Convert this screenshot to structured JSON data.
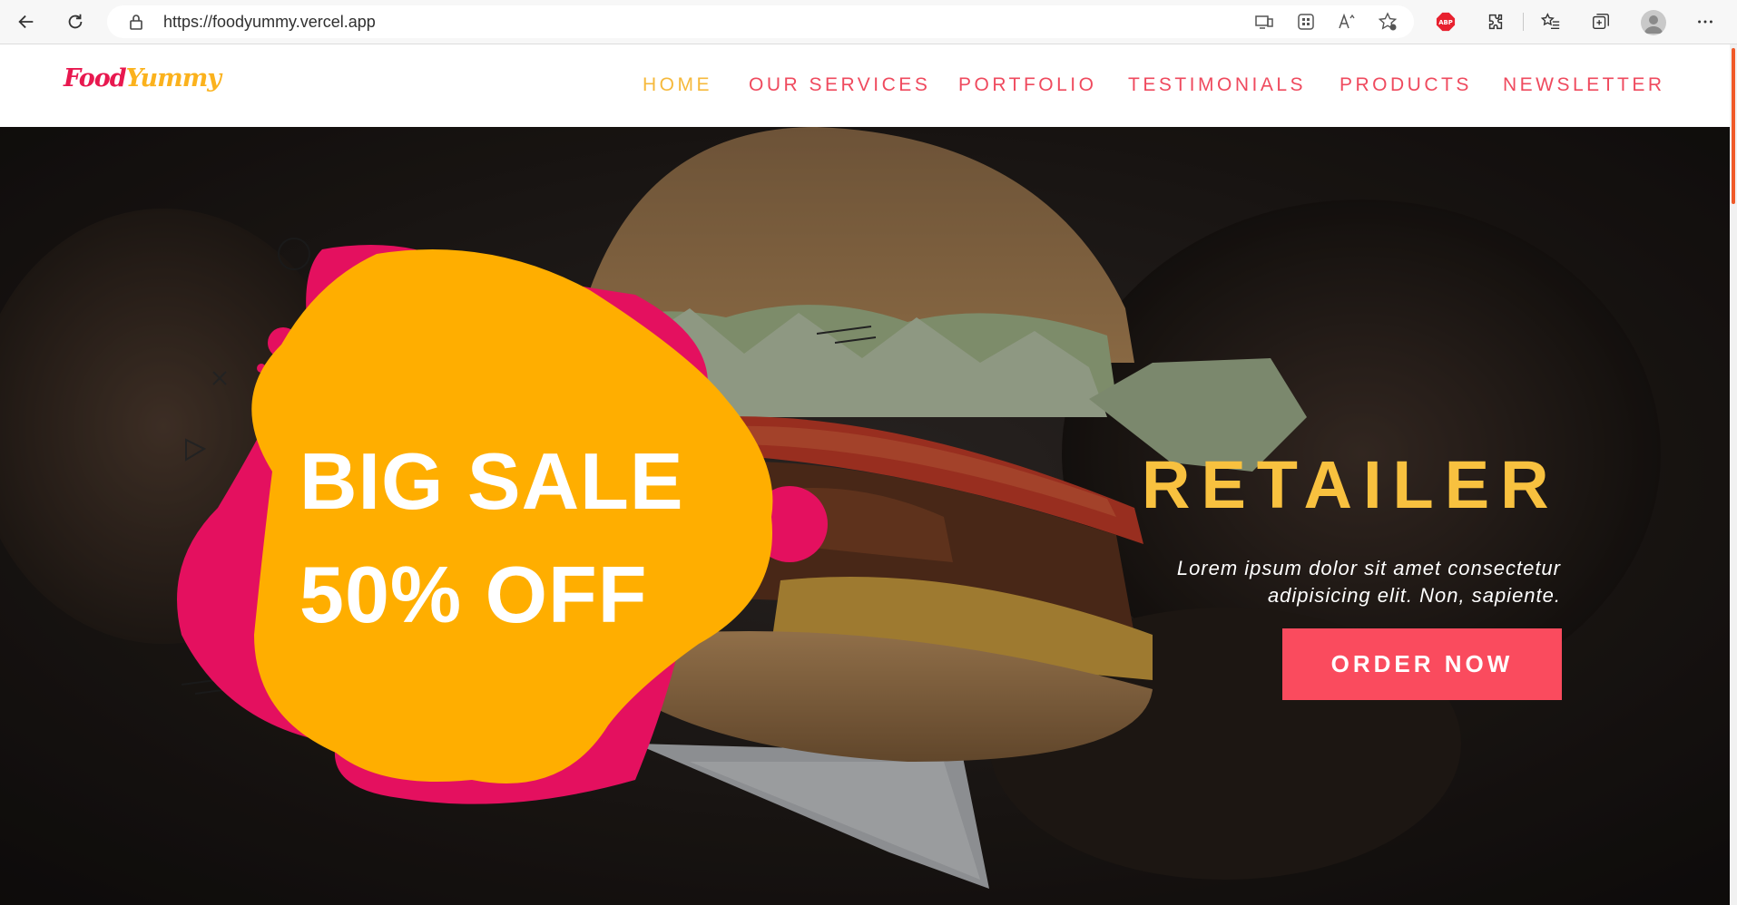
{
  "browser": {
    "url": "https://foodyummy.vercel.app",
    "abp_label": "ABP"
  },
  "site": {
    "logo_part1": "Food",
    "logo_part2": "Yummy",
    "nav": [
      {
        "label": "HOME",
        "active": true
      },
      {
        "label": "OUR SERVICES",
        "active": false
      },
      {
        "label": "PORTFOLIO",
        "active": false
      },
      {
        "label": "TESTIMONIALS",
        "active": false
      },
      {
        "label": "PRODUCTS",
        "active": false
      },
      {
        "label": "NEWSLETTER",
        "active": false
      }
    ]
  },
  "hero": {
    "sale_line1": "BIG SALE",
    "sale_line2": "50% OFF",
    "heading": "RETAILER",
    "text_line1": "Lorem ipsum dolor sit amet consectetur",
    "text_line2": "adipisicing elit. Non, sapiente.",
    "cta_label": "ORDER NOW"
  },
  "colors": {
    "accent_red": "#fa4b5e",
    "accent_yellow": "#f8c13f",
    "blob_orange": "#ffae00",
    "blob_pink": "#e4105f"
  }
}
